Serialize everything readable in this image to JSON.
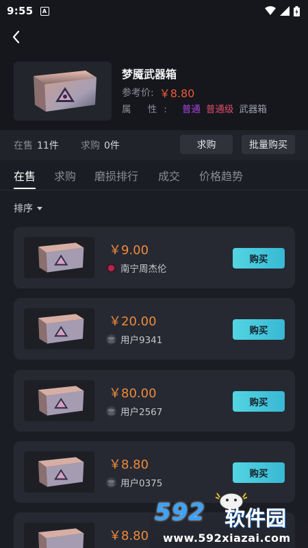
{
  "status_bar": {
    "time": "9:55",
    "notification_icon": "A"
  },
  "product": {
    "title": "梦魇武器箱",
    "ref_label": "参考价:",
    "ref_price": "￥8.80",
    "attr_label": "属 性:",
    "tags": [
      "普通",
      "普通级",
      "武器箱"
    ]
  },
  "stats": {
    "on_sale_label": "在售",
    "on_sale_value": "11件",
    "buy_req_label": "求购",
    "buy_req_value": "0件",
    "buy_request_btn": "求购",
    "bulk_buy_btn": "批量购买"
  },
  "tabs": [
    "在售",
    "求购",
    "磨损排行",
    "成交",
    "价格趋势"
  ],
  "sort_label": "排序",
  "listings": [
    {
      "price": "￥9.00",
      "seller": "南宁周杰伦",
      "buy": "购买"
    },
    {
      "price": "￥20.00",
      "seller": "用户9341",
      "buy": "购买"
    },
    {
      "price": "￥80.00",
      "seller": "用户2567",
      "buy": "购买"
    },
    {
      "price": "￥8.80",
      "seller": "用户0375",
      "buy": "购买"
    },
    {
      "price": "￥8.80",
      "seller": "",
      "buy": ""
    }
  ],
  "watermark": {
    "logo": "592",
    "name": "软件园",
    "url": "www.592xiazai.com"
  },
  "colors": {
    "accent": "#38b8d4",
    "price": "#f08a3a",
    "ref_price": "#f05a3a"
  }
}
